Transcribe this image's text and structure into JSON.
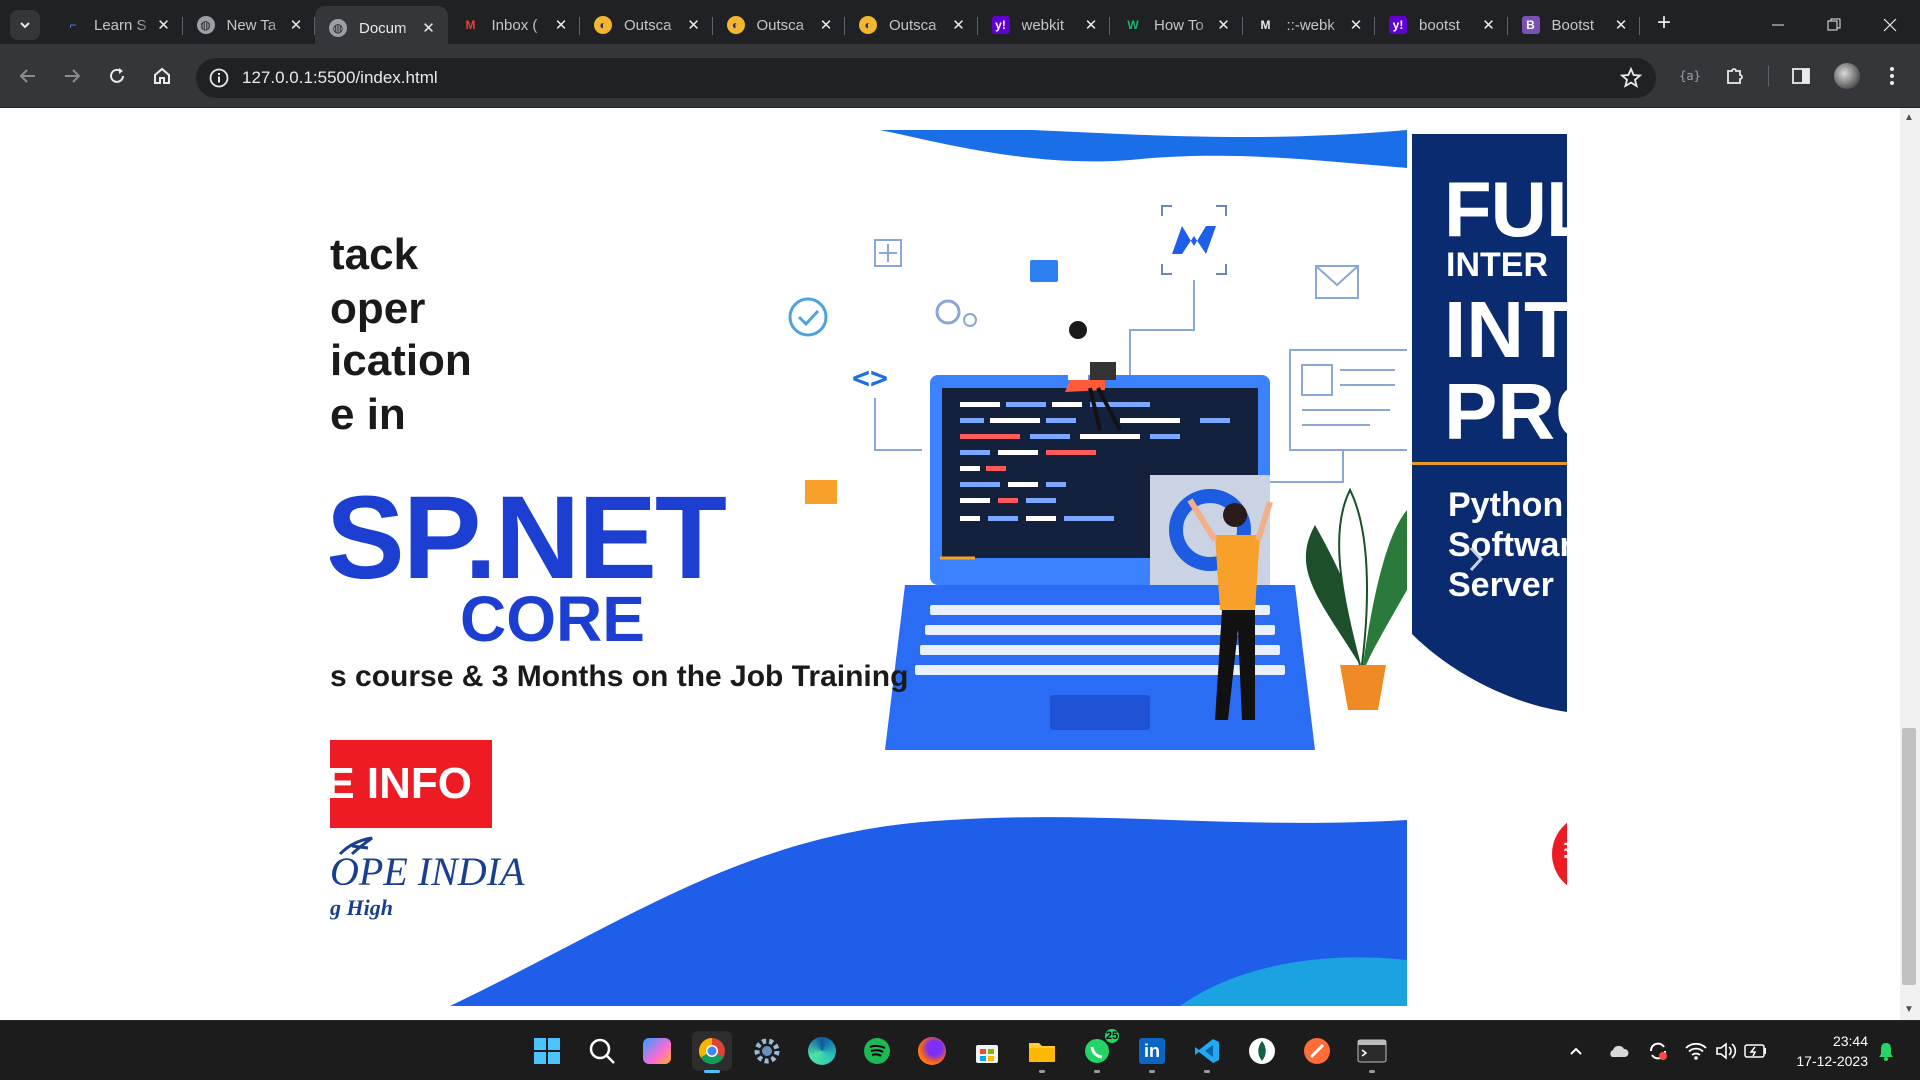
{
  "browser": {
    "tabs": [
      {
        "title": "Learn S",
        "favicon": "learn-favicon",
        "active": false
      },
      {
        "title": "New Ta",
        "favicon": "globe-icon",
        "active": false
      },
      {
        "title": "Docum",
        "favicon": "globe-icon",
        "active": true
      },
      {
        "title": "Inbox (",
        "favicon": "gmail-icon",
        "active": false
      },
      {
        "title": "Outsca",
        "favicon": "outscal-icon",
        "active": false
      },
      {
        "title": "Outsca",
        "favicon": "outscal-icon",
        "active": false
      },
      {
        "title": "Outsca",
        "favicon": "outscal-icon",
        "active": false
      },
      {
        "title": "webkit",
        "favicon": "yahoo-icon",
        "active": false
      },
      {
        "title": "How To",
        "favicon": "w-icon",
        "active": false
      },
      {
        "title": "::-webk",
        "favicon": "m-icon",
        "active": false
      },
      {
        "title": "bootst",
        "favicon": "yahoo-icon",
        "active": false
      },
      {
        "title": "Bootst",
        "favicon": "bootstrap-icon",
        "active": false
      }
    ],
    "url": "127.0.0.1:5500/index.html"
  },
  "banner1": {
    "lines": [
      "tack",
      "oper",
      "ication",
      "e in"
    ],
    "tech": "SP.NET",
    "tech_sub": "CORE",
    "course_line": "s course & 3 Months on the Job Training",
    "info_button": "E INFO",
    "logo_name": "OPE INDIA",
    "logo_tag": "g High"
  },
  "banner2": {
    "line1": "FUL",
    "line2": "INTER",
    "line3": "INT",
    "line4": "PRO",
    "sub1": "Python",
    "sub2": "Softwar",
    "sub3": "Server"
  },
  "taskbar": {
    "whatsapp_badge": "25",
    "time": "23:44",
    "date": "17-12-2023"
  },
  "colors": {
    "brand_blue": "#1c3fd1",
    "info_red": "#ed1c24",
    "navy": "#0a2b6f",
    "orange": "#e49a1a"
  }
}
